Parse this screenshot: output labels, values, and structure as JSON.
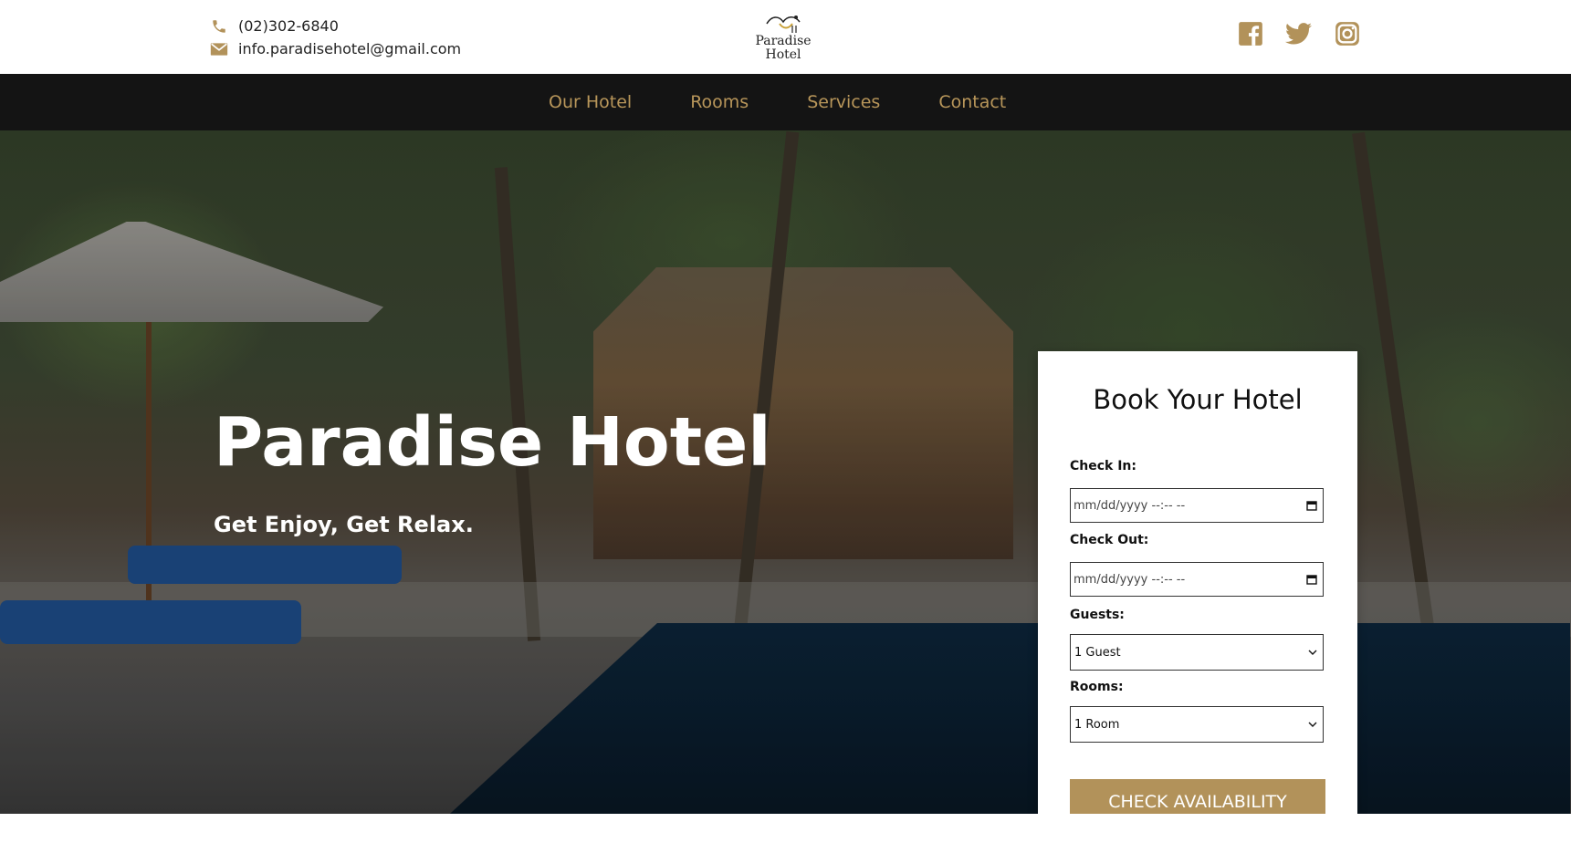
{
  "colors": {
    "accent": "#b2925a",
    "nav_bg": "#141414",
    "nav_text": "#b8965a"
  },
  "topbar": {
    "phone": "(02)302-6840",
    "phone_icon": "phone-icon",
    "email": "info.paradisehotel@gmail.com",
    "email_icon": "mail-icon",
    "logo": {
      "line1": "Paradise",
      "line2": "Hotel"
    },
    "socials": [
      "facebook-icon",
      "twitter-icon",
      "instagram-icon"
    ]
  },
  "nav": {
    "items": [
      {
        "label": "Our Hotel"
      },
      {
        "label": "Rooms"
      },
      {
        "label": "Services"
      },
      {
        "label": "Contact"
      }
    ]
  },
  "hero": {
    "title": "Paradise Hotel",
    "subtitle": "Get Enjoy, Get Relax."
  },
  "booking": {
    "title": "Book Your Hotel",
    "check_in": {
      "label": "Check In:",
      "placeholder": "mm/dd/yyyy --:-- --"
    },
    "check_out": {
      "label": "Check Out:",
      "placeholder": "mm/dd/yyyy --:-- --"
    },
    "guests": {
      "label": "Guests:",
      "value": "1 Guest"
    },
    "rooms": {
      "label": "Rooms:",
      "value": "1 Room"
    },
    "button": "CHECK AVAILABILITY"
  }
}
